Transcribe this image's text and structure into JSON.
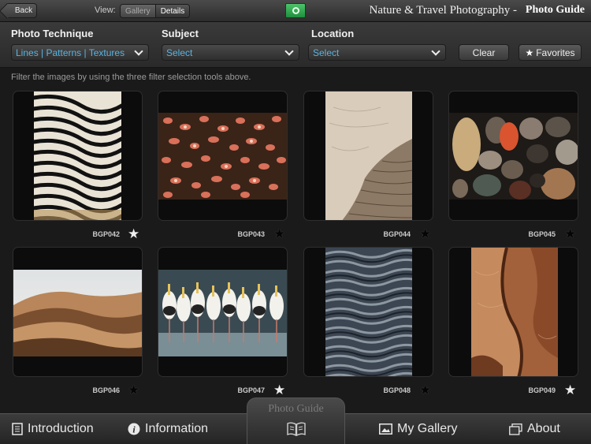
{
  "topbar": {
    "back_label": "Back",
    "view_label": "View:",
    "view_options": [
      "Gallery",
      "Details"
    ],
    "view_selected": "Details",
    "app_title": "Nature & Travel Photography -",
    "guide_title": "Photo Guide"
  },
  "filters": {
    "technique": {
      "label": "Photo Technique",
      "value": "Lines | Patterns | Textures"
    },
    "subject": {
      "label": "Subject",
      "value": "Select"
    },
    "location": {
      "label": "Location",
      "value": "Select"
    },
    "clear_label": "Clear",
    "favorites_label": "Favorites",
    "hint": "Filter the images by using the three filter selection tools above."
  },
  "gallery": [
    {
      "id": "BGP042",
      "subject": "zebras",
      "favorite": false
    },
    {
      "id": "BGP043",
      "subject": "red crabs",
      "favorite": true
    },
    {
      "id": "BGP044",
      "subject": "elephant skin",
      "favorite": true
    },
    {
      "id": "BGP045",
      "subject": "pebbles",
      "favorite": true
    },
    {
      "id": "BGP046",
      "subject": "sand dunes",
      "favorite": true
    },
    {
      "id": "BGP047",
      "subject": "storks",
      "favorite": false
    },
    {
      "id": "BGP048",
      "subject": "sand ripples",
      "favorite": true
    },
    {
      "id": "BGP049",
      "subject": "rock",
      "favorite": false
    }
  ],
  "bottom_nav": {
    "introduction": "Introduction",
    "information": "Information",
    "center": "Photo Guide",
    "my_gallery": "My Gallery",
    "about": "About"
  },
  "colors": {
    "accent_blue": "#5ab3e0",
    "green_button": "#2fa04f"
  }
}
